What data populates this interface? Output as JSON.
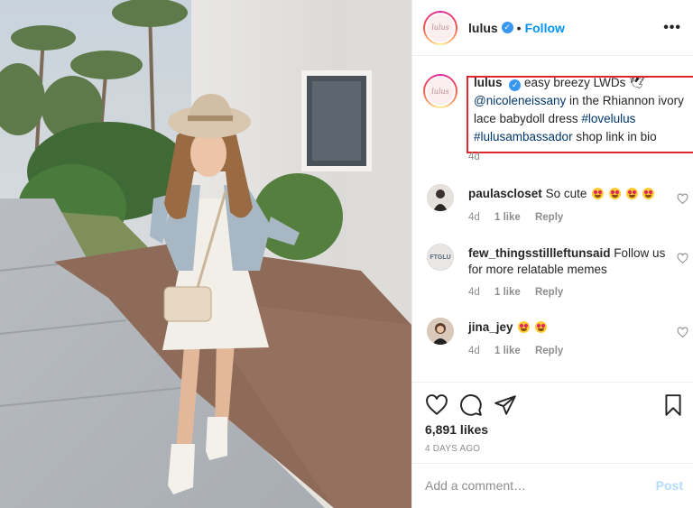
{
  "post": {
    "username": "lulus",
    "avatar_text": "lulus",
    "follow_label": "Follow",
    "more_icon": "more-horizontal-icon",
    "caption": {
      "username": "lulus",
      "text_1": "easy breezy LWDs 🕊",
      "mention": "@nicoleneissany",
      "text_2": "in the Rhiannon ivory lace babydoll dress",
      "hashtag_1": "#lovelulus",
      "hashtag_2": "#lulusambassador",
      "text_3": "shop link in bio",
      "time": "4d"
    },
    "comments": [
      {
        "username": "paulascloset",
        "text": "So cute",
        "emoji_count": 4,
        "time": "4d",
        "likes": "1 like",
        "reply": "Reply"
      },
      {
        "username": "few_thingsstillleftunsaid",
        "avatar_text": "FTGLU",
        "text": "Follow us for more relatable memes",
        "time": "4d",
        "likes": "1 like",
        "reply": "Reply"
      },
      {
        "username": "jina_jey",
        "text": "",
        "emoji_count": 2,
        "time": "4d",
        "likes": "1 like",
        "reply": "Reply"
      }
    ],
    "likes_count": "6,891 likes",
    "posted_ago": "4 DAYS AGO",
    "comment_placeholder": "Add a comment…",
    "post_label": "Post",
    "colors": {
      "follow": "#0095f6",
      "highlight_box": "#e0262d",
      "hashtag": "#00376b",
      "post_disabled": "#b3dbff"
    }
  }
}
